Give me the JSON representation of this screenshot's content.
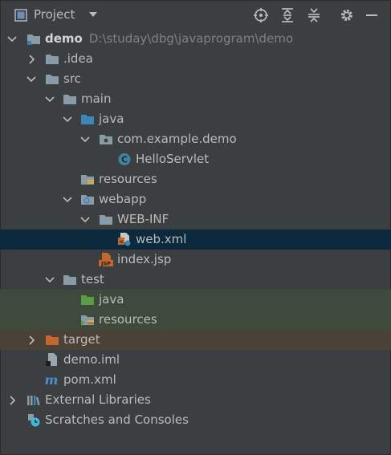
{
  "panel": {
    "title": "Project",
    "tools": [
      "locate-icon",
      "expand-all-icon",
      "collapse-all-icon",
      "gear-icon",
      "minimize-icon"
    ]
  },
  "tree": {
    "root": {
      "name": "demo",
      "path": "D:\\studay\\dbg\\javaprogram\\demo"
    },
    "idea": ".idea",
    "src": "src",
    "main": "main",
    "main_java": "java",
    "package": "com.example.demo",
    "servlet": "HelloServlet",
    "main_resources": "resources",
    "webapp": "webapp",
    "webinf": "WEB-INF",
    "webxml": "web.xml",
    "indexjsp": "index.jsp",
    "test": "test",
    "test_java": "java",
    "test_resources": "resources",
    "target": "target",
    "iml": "demo.iml",
    "pom": "pom.xml",
    "external": "External Libraries",
    "scratches": "Scratches and Consoles"
  },
  "colors": {
    "background": "#3c3f41",
    "selection": "#0d293e",
    "test_highlight": "#3e4a3b",
    "excluded_highlight": "#4a4137",
    "source_folder": "#3d87b8",
    "test_folder": "#5d9a48",
    "excluded_folder": "#c4672f"
  }
}
